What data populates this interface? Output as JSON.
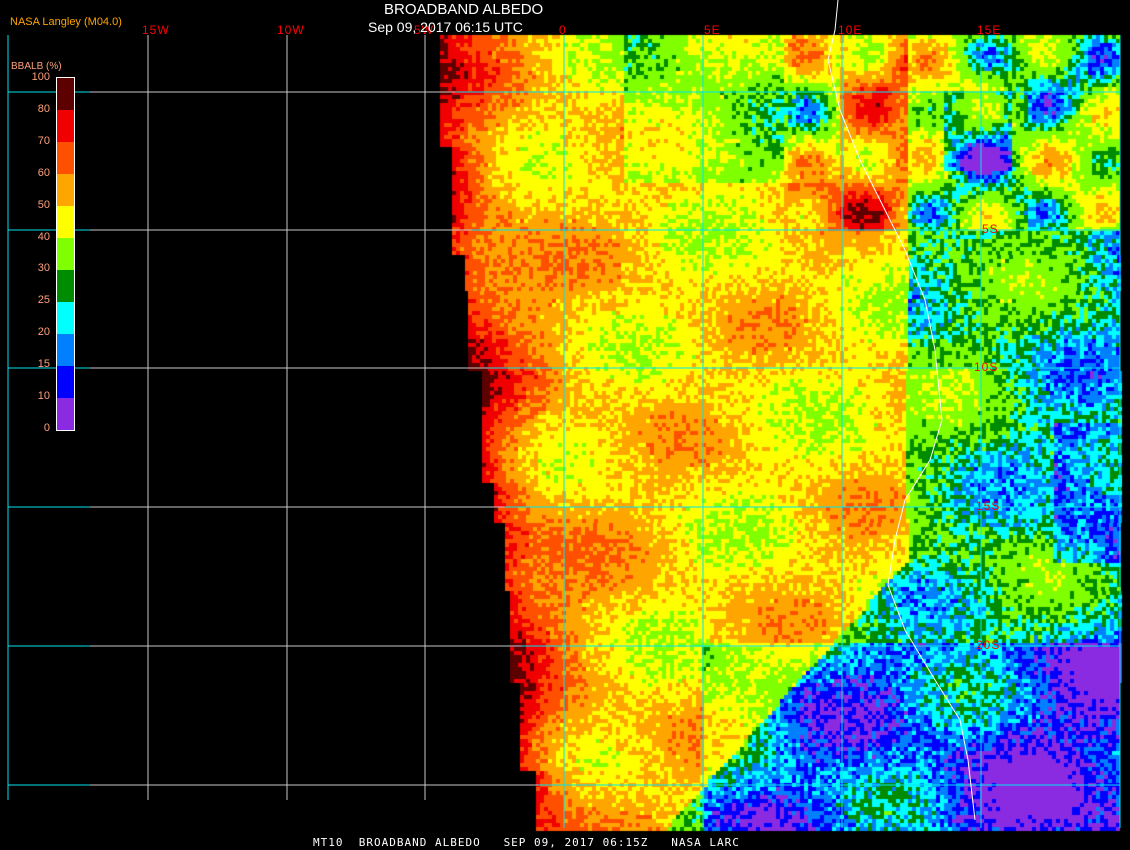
{
  "header": {
    "title": "BROADBAND ALBEDO",
    "datetime": "Sep 09, 2017 06:15 UTC",
    "credit": "NASA Langley (M04.0)"
  },
  "longitude_labels": [
    "15W",
    "10W",
    "5W",
    "0",
    "5E",
    "10E",
    "15E"
  ],
  "latitude_labels": [
    "5S",
    "10S",
    "15S",
    "20S"
  ],
  "legend": {
    "title": "BBALB (%)",
    "labels": [
      "100",
      "80",
      "70",
      "60",
      "50",
      "40",
      "30",
      "25",
      "20",
      "15",
      "10",
      "0"
    ],
    "colors": [
      "#5c0000",
      "#f00000",
      "#ff5000",
      "#ffa500",
      "#ffff00",
      "#80ff00",
      "#008c00",
      "#00ffff",
      "#0080ff",
      "#0000ff",
      "#8a2be2"
    ]
  },
  "footer": {
    "text": "MT10  BROADBAND ALBEDO   SEP 09, 2017 06:15Z   NASA LARC"
  },
  "colors": {
    "grid": "#00e5ee",
    "grid_dark": "#c8c8c8",
    "labels": "#ff0000"
  }
}
